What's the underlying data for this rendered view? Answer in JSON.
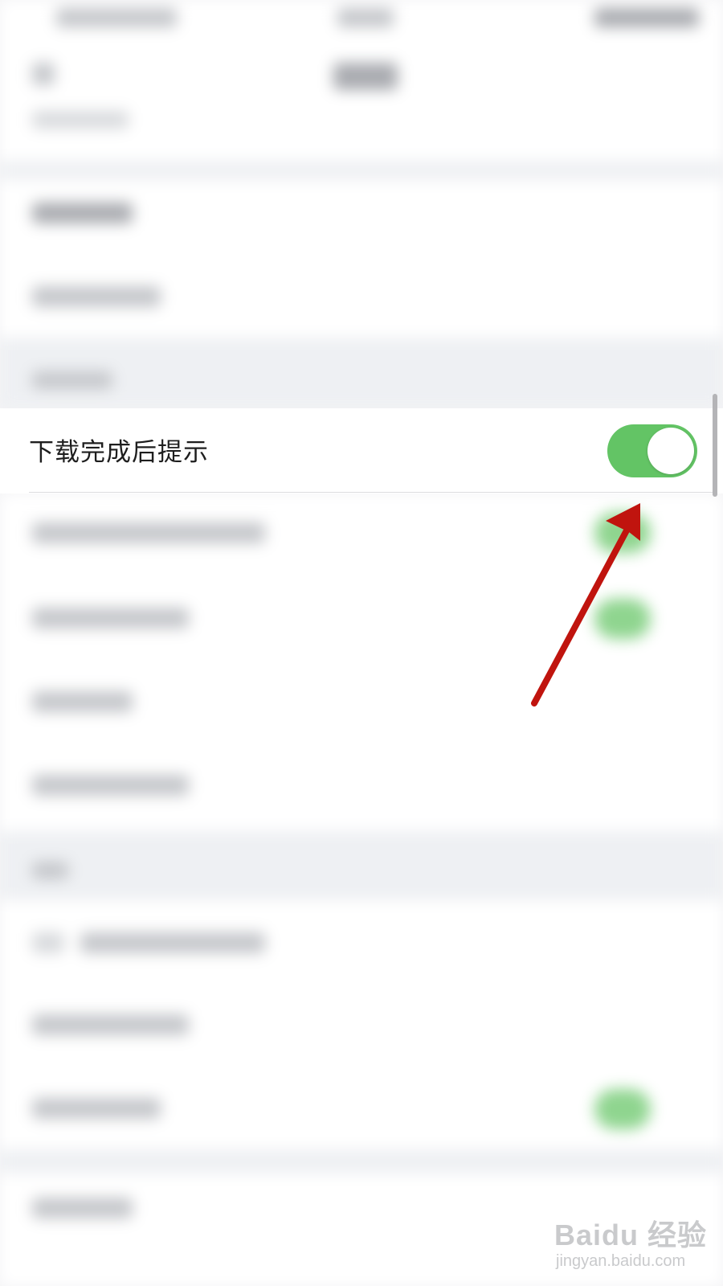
{
  "setting": {
    "label": "下载完成后提示",
    "toggle_on": true
  },
  "colors": {
    "toggle_active": "#63c465",
    "annotation_arrow": "#c0140e",
    "background": "#f4f4f6"
  },
  "icons": {
    "annotation": "red-arrow-icon",
    "watermark": "baidu-jingyan-logo"
  },
  "watermark": {
    "logo_text": "Baidu 经验",
    "url": "jingyan.baidu.com"
  }
}
